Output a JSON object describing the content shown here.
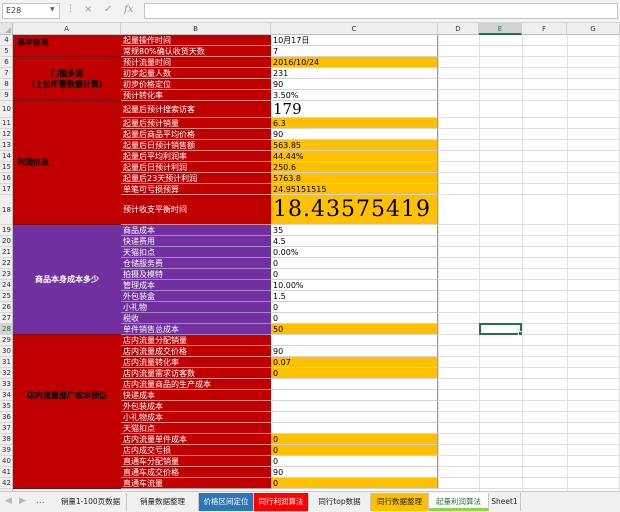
{
  "formula_bar": {
    "name_box": "E28",
    "cancel_icon": "×",
    "enter_icon": "✓",
    "fx_label": "fx",
    "formula": ""
  },
  "columns": [
    "A",
    "B",
    "C",
    "D",
    "E",
    "F",
    "G"
  ],
  "selected_column": "E",
  "selected_row": "28",
  "rows": [
    "4",
    "5",
    "6",
    "7",
    "8",
    "9",
    "10",
    "11",
    "12",
    "13",
    "14",
    "15",
    "16",
    "17",
    "18",
    "19",
    "20",
    "21",
    "22",
    "23",
    "24",
    "25",
    "26",
    "27",
    "28",
    "29",
    "30",
    "31",
    "32",
    "33",
    "34",
    "35",
    "36",
    "37",
    "38",
    "39",
    "40",
    "41",
    "42"
  ],
  "sections": {
    "basic_info": "基本信息",
    "portal_line1": "门槛多高",
    "portal_line2": "（上位所需数据计算）",
    "profit_info": "利润信息",
    "product_cost": "商品本身成本多少",
    "traffic_cost": "店内流量推广成本预估"
  },
  "cells": [
    {
      "b": "起量操作时间",
      "c": "10月17日",
      "cfill": "white"
    },
    {
      "b": "常规80%确认收货天数",
      "c": "7",
      "cfill": "white"
    },
    {
      "b": "预计流量时间",
      "c": "2016/10/24",
      "cfill": "orange"
    },
    {
      "b": "初步起量人数",
      "c": "231",
      "cfill": "white"
    },
    {
      "b": "初步价格定位",
      "c": "90",
      "cfill": "white"
    },
    {
      "b": "预计转化率",
      "c": "3.50%",
      "cfill": "white"
    },
    {
      "b": "起量后预计搜索访客",
      "c": "179",
      "cfill": "white"
    },
    {
      "b": "起量后预计销量",
      "c": "6.3",
      "cfill": "orange"
    },
    {
      "b": "起量后商品平均价格",
      "c": "90",
      "cfill": "white"
    },
    {
      "b": "起量后日预计销售额",
      "c": "563.85",
      "cfill": "orange"
    },
    {
      "b": "起量后平均利润率",
      "c": "44.44%",
      "cfill": "orange"
    },
    {
      "b": "起量后日预计利润",
      "c": "250.6",
      "cfill": "orange"
    },
    {
      "b": "起量后23天预计利润",
      "c": "5763.8",
      "cfill": "orange"
    },
    {
      "b": "单笔可亏损预算",
      "c": "24.95151515",
      "cfill": "orange"
    },
    {
      "b": "预计收支平衡时间",
      "c": "18.43575419",
      "cfill": "orange"
    },
    {
      "b": "商品成本",
      "c": "35",
      "cfill": "white"
    },
    {
      "b": "快递费用",
      "c": "4.5",
      "cfill": "white"
    },
    {
      "b": "天猫扣点",
      "c": "0.00%",
      "cfill": "white"
    },
    {
      "b": "仓储服务费",
      "c": "0",
      "cfill": "white"
    },
    {
      "b": "拍摄及模特",
      "c": "0",
      "cfill": "white"
    },
    {
      "b": "管理成本",
      "c": "10.00%",
      "cfill": "white"
    },
    {
      "b": "外包装盒",
      "c": "1.5",
      "cfill": "white"
    },
    {
      "b": "小礼物",
      "c": "0",
      "cfill": "white"
    },
    {
      "b": "税收",
      "c": "0",
      "cfill": "white"
    },
    {
      "b": "单件销售总成本",
      "c": "50",
      "cfill": "orange"
    },
    {
      "b": "店内流量分配销量",
      "c": "",
      "cfill": "white"
    },
    {
      "b": "店内流量成交价格",
      "c": "90",
      "cfill": "white"
    },
    {
      "b": "店内流量转化率",
      "c": "0.07",
      "cfill": "orange"
    },
    {
      "b": "店内流量需求访客数",
      "c": "0",
      "cfill": "orange"
    },
    {
      "b": "店内流量商品的生产成本",
      "c": "",
      "cfill": "white"
    },
    {
      "b": "快递成本",
      "c": "",
      "cfill": "white"
    },
    {
      "b": "外包装成本",
      "c": "",
      "cfill": "white"
    },
    {
      "b": "小礼物成本",
      "c": "",
      "cfill": "white"
    },
    {
      "b": "天猫扣点",
      "c": "",
      "cfill": "white"
    },
    {
      "b": "店内流量单件成本",
      "c": "0",
      "cfill": "orange"
    },
    {
      "b": "店内成交亏损",
      "c": "0",
      "cfill": "orange"
    },
    {
      "b": "直通车分配销量",
      "c": "0",
      "cfill": "white"
    },
    {
      "b": "直通车成交价格",
      "c": "90",
      "cfill": "white"
    },
    {
      "b": "直通车流量",
      "c": "0",
      "cfill": "orange"
    }
  ],
  "sheet_tabs": [
    {
      "label": "销量1-100页数据",
      "color": "#f1f1f1"
    },
    {
      "label": "销量数据整理",
      "color": "#f1f1f1"
    },
    {
      "label": "价格区间定位",
      "color": "#2e75b6"
    },
    {
      "label": "同行利润算法",
      "color": "#ff0000"
    },
    {
      "label": "同行top数据",
      "color": "#f1f1f1"
    },
    {
      "label": "同行数据整理",
      "color": "#ffc000"
    },
    {
      "label": "起量利润算法",
      "color": "#92d050",
      "active": true
    },
    {
      "label": "Sheet1",
      "color": "#f1f1f1"
    }
  ],
  "icons": {
    "tab_prev": "◀",
    "tab_next": "▶",
    "tab_more": "..."
  }
}
